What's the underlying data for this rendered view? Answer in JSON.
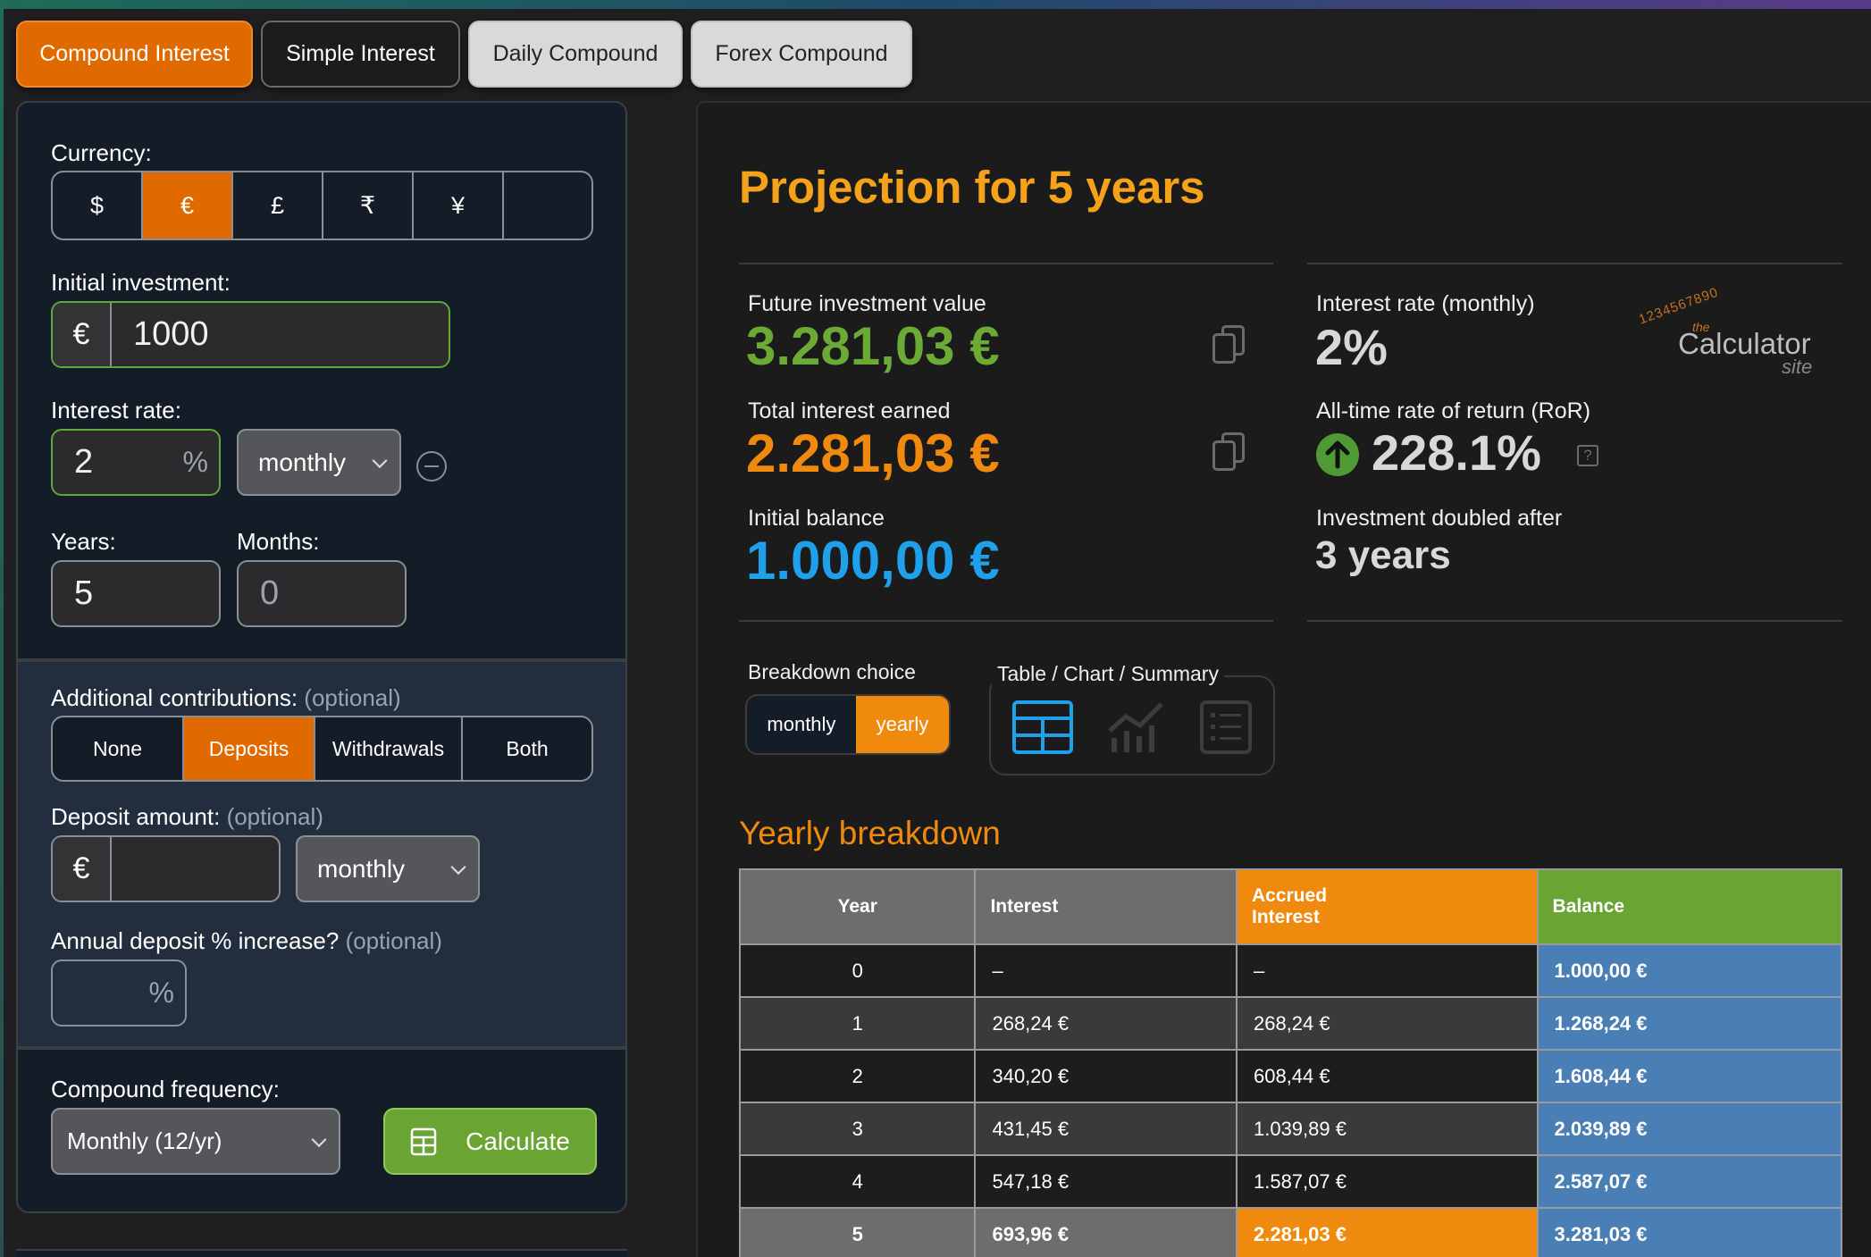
{
  "tabs": [
    "Compound Interest",
    "Simple Interest",
    "Daily Compound",
    "Forex Compound"
  ],
  "form": {
    "currency_label": "Currency:",
    "currencies": [
      "$",
      "€",
      "£",
      "₹",
      "¥",
      ""
    ],
    "selected_currency": "€",
    "initial_label": "Initial investment:",
    "initial_value": "1000",
    "rate_label": "Interest rate:",
    "rate_value": "2",
    "rate_unit": "%",
    "rate_period": "monthly",
    "years_label": "Years:",
    "years_value": "5",
    "months_label": "Months:",
    "months_value": "0",
    "contrib_label": "Additional contributions:",
    "optional": "(optional)",
    "contrib_options": [
      "None",
      "Deposits",
      "Withdrawals",
      "Both"
    ],
    "contrib_selected": "Deposits",
    "deposit_label": "Deposit amount:",
    "deposit_value": "",
    "deposit_period": "monthly",
    "annual_inc_label": "Annual deposit % increase?",
    "annual_inc_unit": "%",
    "freq_label": "Compound frequency:",
    "freq_value": "Monthly (12/yr)",
    "calculate": "Calculate"
  },
  "results": {
    "title": "Projection for 5 years",
    "future_label": "Future investment value",
    "future_value": "3.281,03 €",
    "interest_label": "Total interest earned",
    "interest_value": "2.281,03 €",
    "initial_label": "Initial balance",
    "initial_value": "1.000,00 €",
    "rate_label": "Interest rate (monthly)",
    "rate_value": "2%",
    "ror_label": "All-time rate of return (RoR)",
    "ror_value": "228.1%",
    "doubled_label": "Investment doubled after",
    "doubled_value": "3 years",
    "logo_text": "Calculator",
    "logo_the": "the",
    "logo_site": "site",
    "logo_digits": "1234567890",
    "breakdown_label": "Breakdown choice",
    "breakdown_options": [
      "monthly",
      "yearly"
    ],
    "breakdown_selected": "yearly",
    "view_label": "Table / Chart / Summary",
    "table_title": "Yearly breakdown"
  },
  "colors": {
    "accent": "#e06900",
    "future": "#6aaa35",
    "interest": "#f08a0e",
    "initial": "#1ea0ea",
    "balance_col": "#4a7fb5",
    "calc_btn": "#6aa533"
  },
  "table": {
    "headers": [
      "Year",
      "Interest",
      "Accrued Interest",
      "Balance"
    ],
    "rows": [
      [
        "0",
        "–",
        "–",
        "1.000,00 €"
      ],
      [
        "1",
        "268,24 €",
        "268,24 €",
        "1.268,24 €"
      ],
      [
        "2",
        "340,20 €",
        "608,44 €",
        "1.608,44 €"
      ],
      [
        "3",
        "431,45 €",
        "1.039,89 €",
        "2.039,89 €"
      ],
      [
        "4",
        "547,18 €",
        "1.587,07 €",
        "2.587,07 €"
      ],
      [
        "5",
        "693,96 €",
        "2.281,03 €",
        "3.281,03 €"
      ]
    ]
  }
}
